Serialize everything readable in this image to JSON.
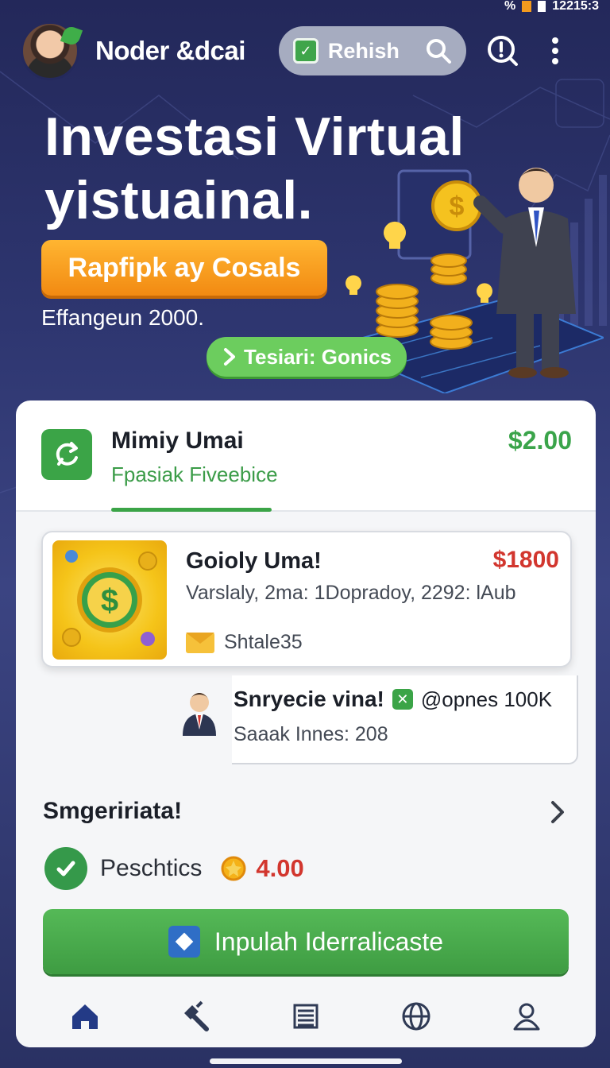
{
  "status_bar": {
    "time": "12215:3",
    "signal": "%"
  },
  "header": {
    "app_name": "Noder &dcai",
    "search_label": "Rehish",
    "icons": [
      "avatar",
      "check-icon",
      "search-icon",
      "alert-icon",
      "more-icon"
    ]
  },
  "hero": {
    "title_line1": "Investasi Virtual",
    "title_line2": "yistuainal.",
    "cta_label": "Rapfipk ay Cosals",
    "subtitle": "Effangeun 2000.",
    "pill_label": "Tesiari: Gonics"
  },
  "account": {
    "title": "Mimiy Umai",
    "subtitle": "Fpasiak Fiveebice",
    "amount": "$2.00"
  },
  "transactions": [
    {
      "title": "Goioly Uma!",
      "amount": "$1800",
      "detail": "Varslaly, 2ma: 1Dopradoy, 2292: lAub",
      "meta": "Shtale35"
    },
    {
      "title": "Snryecie vina!",
      "handle": "@opnes 100K",
      "detail": "Saaak Innes: 208"
    }
  ],
  "section": {
    "title": "Smgeririata!",
    "stat_label": "Peschtics",
    "stat_value": "4.00"
  },
  "primary_button": {
    "label": "Inpulah Iderralicaste"
  },
  "bottom_nav": [
    "home-icon",
    "hammer-icon",
    "ledger-icon",
    "globe-icon",
    "profile-icon"
  ],
  "colors": {
    "accent_green": "#3ba447",
    "accent_orange": "#f28a12",
    "negative_red": "#d2362e",
    "background_navy": "#2a3163"
  }
}
